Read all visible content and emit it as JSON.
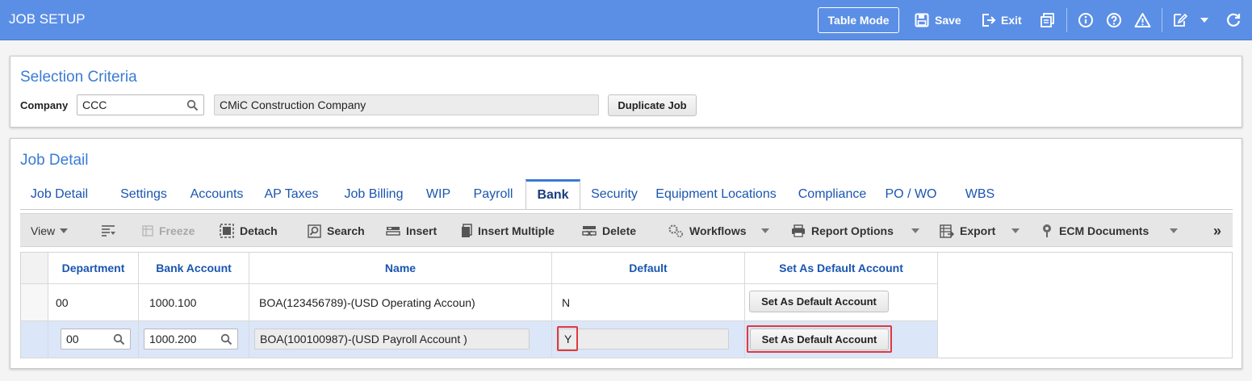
{
  "app": {
    "title": "JOB SETUP"
  },
  "topbar": {
    "table_mode": "Table Mode",
    "save": "Save",
    "exit": "Exit",
    "icons": [
      "save-icon",
      "exit-icon",
      "print-icon",
      "info-icon",
      "help-icon",
      "warning-icon",
      "edit-icon",
      "dropdown-icon",
      "refresh-icon"
    ]
  },
  "selection": {
    "title": "Selection Criteria",
    "company_label": "Company",
    "company_value": "CCC",
    "company_name": "CMiC Construction Company",
    "duplicate_button": "Duplicate Job"
  },
  "detail": {
    "title": "Job Detail",
    "tabs": [
      "Job Detail",
      "Settings",
      "Accounts",
      "AP Taxes",
      "Job Billing",
      "WIP",
      "Payroll",
      "Bank",
      "Security",
      "Equipment Locations",
      "Compliance",
      "PO / WO",
      "WBS"
    ],
    "active_tab": "Bank"
  },
  "toolbar": {
    "view": "View",
    "freeze": "Freeze",
    "detach": "Detach",
    "search": "Search",
    "insert": "Insert",
    "insert_multiple": "Insert Multiple",
    "delete": "Delete",
    "workflows": "Workflows",
    "report_options": "Report Options",
    "export": "Export",
    "ecm_documents": "ECM Documents",
    "more": "»"
  },
  "grid": {
    "headers": [
      "Department",
      "Bank Account",
      "Name",
      "Default",
      "Set As Default Account"
    ],
    "rows": [
      {
        "department": "00",
        "bank_account": "1000.100",
        "name": "BOA(123456789)-(USD Operating Accoun)",
        "default": "N",
        "action": "Set As Default Account"
      },
      {
        "department": "00",
        "bank_account": "1000.200",
        "name": "BOA(100100987)-(USD Payroll Account )",
        "default": "Y",
        "action": "Set As Default Account"
      }
    ]
  },
  "colors": {
    "accent": "#5b8fe6",
    "title_blue": "#3a7bd5",
    "highlight": "#e0393e",
    "selected_row": "#dbe6f8"
  }
}
